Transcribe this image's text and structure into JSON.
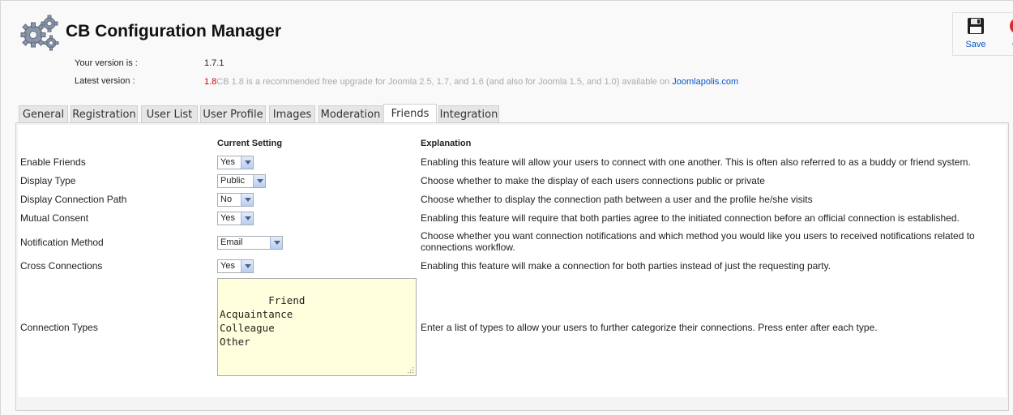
{
  "header": {
    "title": "CB Configuration Manager",
    "logo_icon": "gears-icon"
  },
  "toolbar": {
    "save_label": "Save",
    "save_icon": "floppy-disk-icon",
    "cancel_label": "Ca",
    "cancel_icon": "cancel-icon"
  },
  "version": {
    "your_label": "Your version is :",
    "your_value": "1.7.1",
    "latest_label": "Latest version :",
    "latest_value": "1.8",
    "latest_message": "CB 1.8 is a recommended free upgrade for Joomla 2.5, 1.7, and 1.6 (and also for Joomla 1.5, and 1.0) available on ",
    "latest_link": "Joomlapolis.com"
  },
  "tabs": [
    "General",
    "Registration",
    "User List",
    "User Profile",
    "Images",
    "Moderation",
    "Friends",
    "Integration"
  ],
  "active_tab": "Friends",
  "columns": {
    "setting": "Current Setting",
    "explanation": "Explanation"
  },
  "rows": [
    {
      "label": "Enable Friends",
      "value": "Yes",
      "explanation": "Enabling this feature will allow your users to connect with one another. This is often also referred to as a buddy or friend system."
    },
    {
      "label": "Display Type",
      "value": "Public",
      "explanation": "Choose whether to make the display of each users connections public or private"
    },
    {
      "label": "Display Connection Path",
      "value": "No",
      "explanation": "Choose whether to display the connection path between a user and the profile he/she visits"
    },
    {
      "label": "Mutual Consent",
      "value": "Yes",
      "explanation": "Enabling this feature will require that both parties agree to the initiated connection before an official connection is established."
    },
    {
      "label": "Notification Method",
      "value": "Email",
      "explanation": "Choose whether you want connection notifications and which method you would like you users to received notifications related to connections workflow."
    },
    {
      "label": "Cross Connections",
      "value": "Yes",
      "explanation": "Enabling this feature will make a connection for both parties instead of just the requesting party."
    },
    {
      "label": "Connection Types",
      "value": "Friend\nAcquaintance\nColleague\nOther",
      "explanation": "Enter a list of types to allow your users to further categorize their connections. Press enter after each type."
    }
  ],
  "colors": {
    "latest_version": "#cc0000",
    "link": "#0b55c4",
    "textarea_bg": "#ffffdd"
  }
}
